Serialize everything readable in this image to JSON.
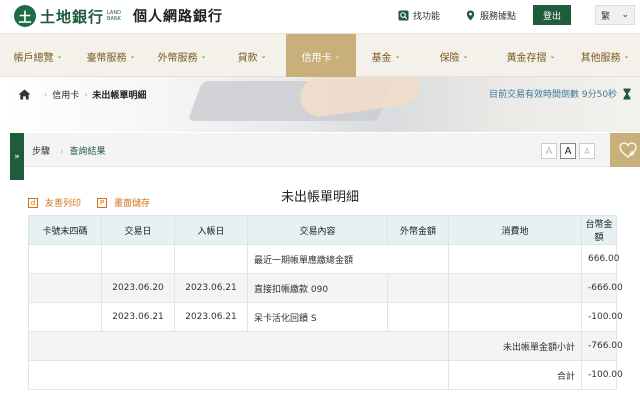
{
  "header": {
    "logo_mark": "土",
    "bank_name": "土地銀行",
    "bank_name_en": "LAND BANK",
    "site_name": "個人網路銀行",
    "find_function": "找功能",
    "service_locations": "服務據點",
    "logout": "登出",
    "language": "繁",
    "language_chevron": "⌄"
  },
  "nav": {
    "items": [
      {
        "label": "帳戶總覽"
      },
      {
        "label": "臺幣服務"
      },
      {
        "label": "外幣服務"
      },
      {
        "label": "貸款"
      },
      {
        "label": "信用卡"
      },
      {
        "label": "基金"
      },
      {
        "label": "保險"
      },
      {
        "label": "黃金存摺"
      },
      {
        "label": "其他服務"
      }
    ],
    "active_index": 4,
    "chevron": "⌄"
  },
  "breadcrumb": {
    "items": [
      "信用卡",
      "未出帳單明細"
    ],
    "separator": "›"
  },
  "session_timer": {
    "text": "目前交易有效時間倒數 9分50秒"
  },
  "step_bar": {
    "toggle": "»",
    "label": "步驟",
    "current": "查詢結果",
    "separator": "›",
    "font_sizes": [
      "A",
      "A",
      "A"
    ],
    "selected_font_index": 1
  },
  "page": {
    "title": "未出帳單明細",
    "print_label": "友善列印",
    "print_icon_letter": "d",
    "save_label": "畫面儲存",
    "save_icon_letter": "P"
  },
  "table": {
    "headers": [
      "卡號末四碼",
      "交易日",
      "入帳日",
      "交易內容",
      "外幣金額",
      "消費地",
      "台幣金額"
    ],
    "rows": [
      {
        "card": "",
        "txn_date": "",
        "post_date": "",
        "desc": "最近一期帳單應繳總金額",
        "fx": "",
        "place": "",
        "twd": "666.00"
      },
      {
        "card": "",
        "txn_date": "2023.06.20",
        "post_date": "2023.06.21",
        "desc": "直接扣帳繳款 090",
        "fx": "",
        "place": "",
        "twd": "-666.00"
      },
      {
        "card": "",
        "txn_date": "2023.06.21",
        "post_date": "2023.06.21",
        "desc": "呆卡活化回饋 S",
        "fx": "",
        "place": "",
        "twd": "-100.00"
      }
    ],
    "subtotal_label": "未出帳單金額小計",
    "subtotal_value": "-766.00",
    "total_label": "合計",
    "total_value": "-100.00"
  },
  "colors": {
    "brand_green": "#1e5c3c",
    "gold": "#c9b07a",
    "nav_text": "#7a5a1e",
    "table_header": "#e6f1f3",
    "link_orange": "#d07018",
    "timer_blue": "#3a7a9a"
  }
}
